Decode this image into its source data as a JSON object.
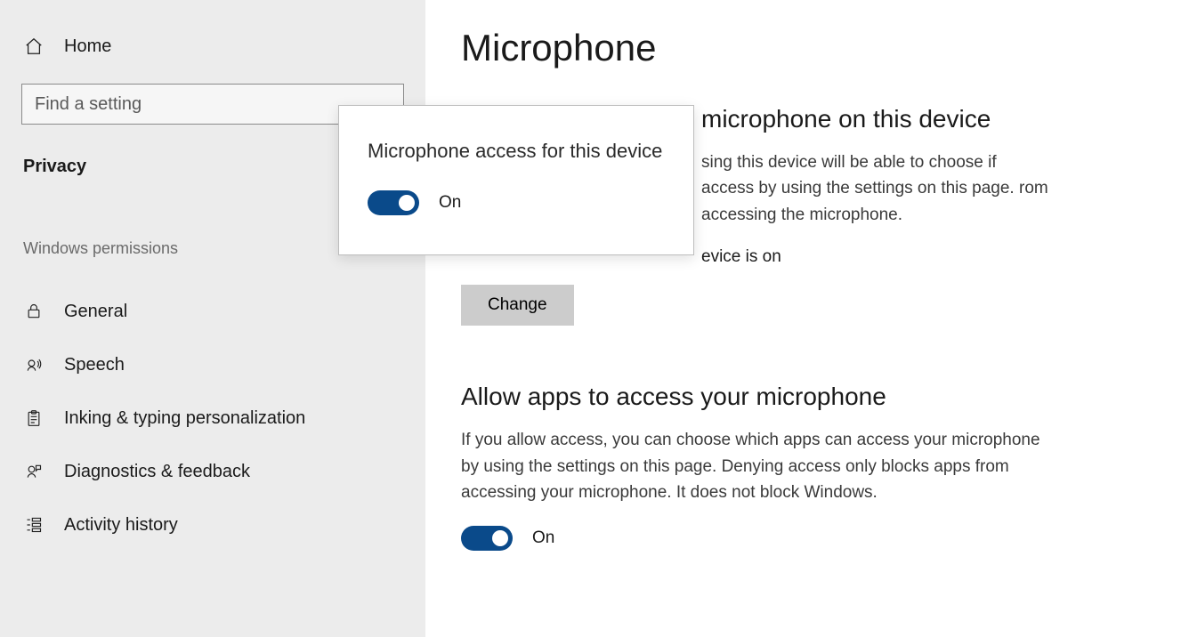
{
  "sidebar": {
    "home_label": "Home",
    "search_placeholder": "Find a setting",
    "current_category": "Privacy",
    "section_header": "Windows permissions",
    "items": [
      {
        "label": "General"
      },
      {
        "label": "Speech"
      },
      {
        "label": "Inking & typing personalization"
      },
      {
        "label": "Diagnostics & feedback"
      },
      {
        "label": "Activity history"
      }
    ]
  },
  "main": {
    "title": "Microphone",
    "section1": {
      "heading_suffix": "microphone on this device",
      "desc_fragment": "sing this device will be able to choose if access by using the settings on this page. rom accessing the microphone.",
      "status_suffix": "evice is on",
      "change_label": "Change"
    },
    "section2": {
      "heading": "Allow apps to access your microphone",
      "desc": "If you allow access, you can choose which apps can access your microphone by using the settings on this page. Denying access only blocks apps from accessing your microphone. It does not block Windows.",
      "toggle_label": "On"
    }
  },
  "popup": {
    "title": "Microphone access for this device",
    "toggle_label": "On"
  }
}
